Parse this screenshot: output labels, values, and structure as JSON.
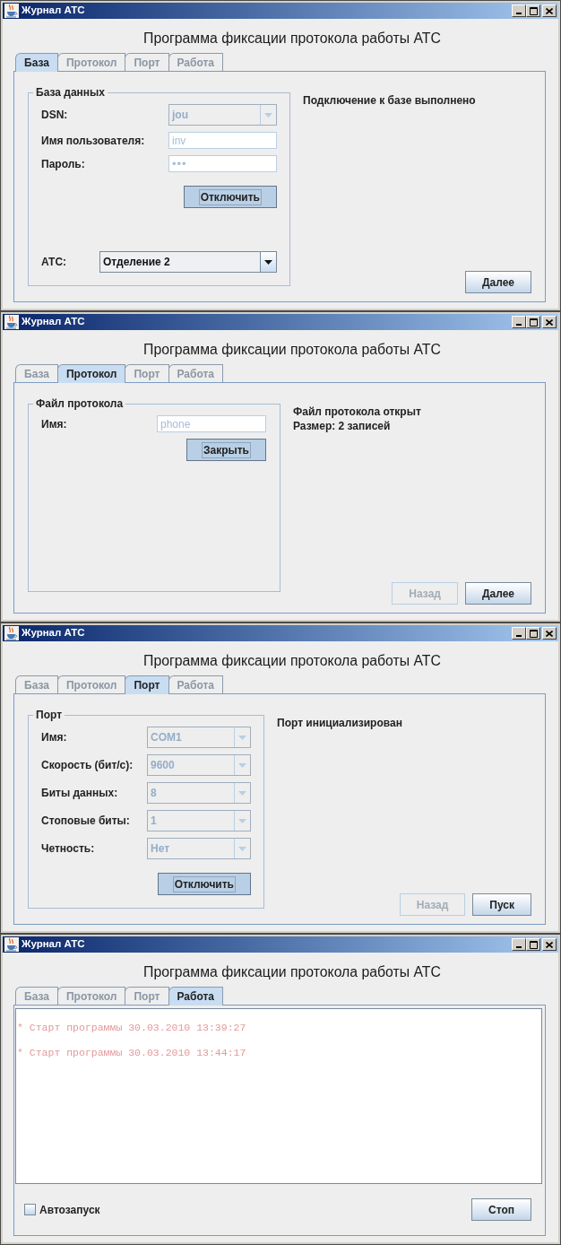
{
  "windows": [
    {
      "title": "Журнал АТС",
      "heading": "Программа фиксации протокола работы АТС",
      "tabs": [
        {
          "label": "База",
          "selected": true
        },
        {
          "label": "Протокол",
          "selected": false
        },
        {
          "label": "Порт",
          "selected": false
        },
        {
          "label": "Работа",
          "selected": false
        }
      ],
      "panel": {
        "kind": "database",
        "group": {
          "legend": "База данных",
          "fields": [
            {
              "kind": "combo",
              "label": "DSN:",
              "value": "jou",
              "disabled": true
            },
            {
              "kind": "text",
              "label": "Имя пользователя:",
              "value": "inv",
              "disabled": true
            },
            {
              "kind": "password",
              "label": "Пароль:",
              "value": "•••",
              "disabled": true
            }
          ],
          "button": {
            "label": "Отключить",
            "pressed": true,
            "focused": true
          },
          "bottom_fields": [
            {
              "kind": "combo",
              "label": "АТС:",
              "value": "Отделение 2",
              "disabled": false
            }
          ]
        },
        "status": [
          "Подключение к базе выполнено"
        ],
        "buttons": [
          {
            "label": "Далее",
            "disabled": false
          }
        ]
      }
    },
    {
      "title": "Журнал АТС",
      "heading": "Программа фиксации протокола работы АТС",
      "tabs": [
        {
          "label": "База",
          "selected": false
        },
        {
          "label": "Протокол",
          "selected": true
        },
        {
          "label": "Порт",
          "selected": false
        },
        {
          "label": "Работа",
          "selected": false
        }
      ],
      "panel": {
        "kind": "protocol",
        "group": {
          "legend": "Файл протокола",
          "fields": [
            {
              "kind": "text",
              "label": "Имя:",
              "value": "phone",
              "disabled": true
            }
          ],
          "button": {
            "label": "Закрыть",
            "pressed": true,
            "focused": true
          }
        },
        "status": [
          "Файл протокола открыт",
          "Размер: 2 записей"
        ],
        "buttons": [
          {
            "label": "Назад",
            "disabled": true
          },
          {
            "label": "Далее",
            "disabled": false
          }
        ]
      }
    },
    {
      "title": "Журнал АТС",
      "heading": "Программа фиксации протокола работы АТС",
      "tabs": [
        {
          "label": "База",
          "selected": false
        },
        {
          "label": "Протокол",
          "selected": false
        },
        {
          "label": "Порт",
          "selected": true
        },
        {
          "label": "Работа",
          "selected": false
        }
      ],
      "panel": {
        "kind": "port",
        "group": {
          "legend": "Порт",
          "fields": [
            {
              "kind": "combo",
              "label": "Имя:",
              "value": "COM1",
              "disabled": true
            },
            {
              "kind": "combo",
              "label": "Скорость (бит/с):",
              "value": "9600",
              "disabled": true
            },
            {
              "kind": "combo",
              "label": "Биты данных:",
              "value": "8",
              "disabled": true
            },
            {
              "kind": "combo",
              "label": "Стоповые биты:",
              "value": "1",
              "disabled": true
            },
            {
              "kind": "combo",
              "label": "Четность:",
              "value": "Нет",
              "disabled": true
            }
          ],
          "button": {
            "label": "Отключить",
            "pressed": true,
            "focused": true
          }
        },
        "status": [
          "Порт инициализирован"
        ],
        "buttons": [
          {
            "label": "Назад",
            "disabled": true
          },
          {
            "label": "Пуск",
            "disabled": false
          }
        ]
      }
    },
    {
      "title": "Журнал АТС",
      "heading": "Программа фиксации протокола работы АТС",
      "tabs": [
        {
          "label": "База",
          "selected": false
        },
        {
          "label": "Протокол",
          "selected": false
        },
        {
          "label": "Порт",
          "selected": false
        },
        {
          "label": "Работа",
          "selected": true
        }
      ],
      "panel": {
        "kind": "log",
        "log": [
          "* Старт программы 30.03.2010 13:39:27",
          "* Старт программы 30.03.2010 13:44:17"
        ],
        "checkbox": {
          "label": "Автозапуск",
          "checked": false
        },
        "buttons": [
          {
            "label": "Стоп",
            "disabled": false
          }
        ]
      }
    }
  ]
}
